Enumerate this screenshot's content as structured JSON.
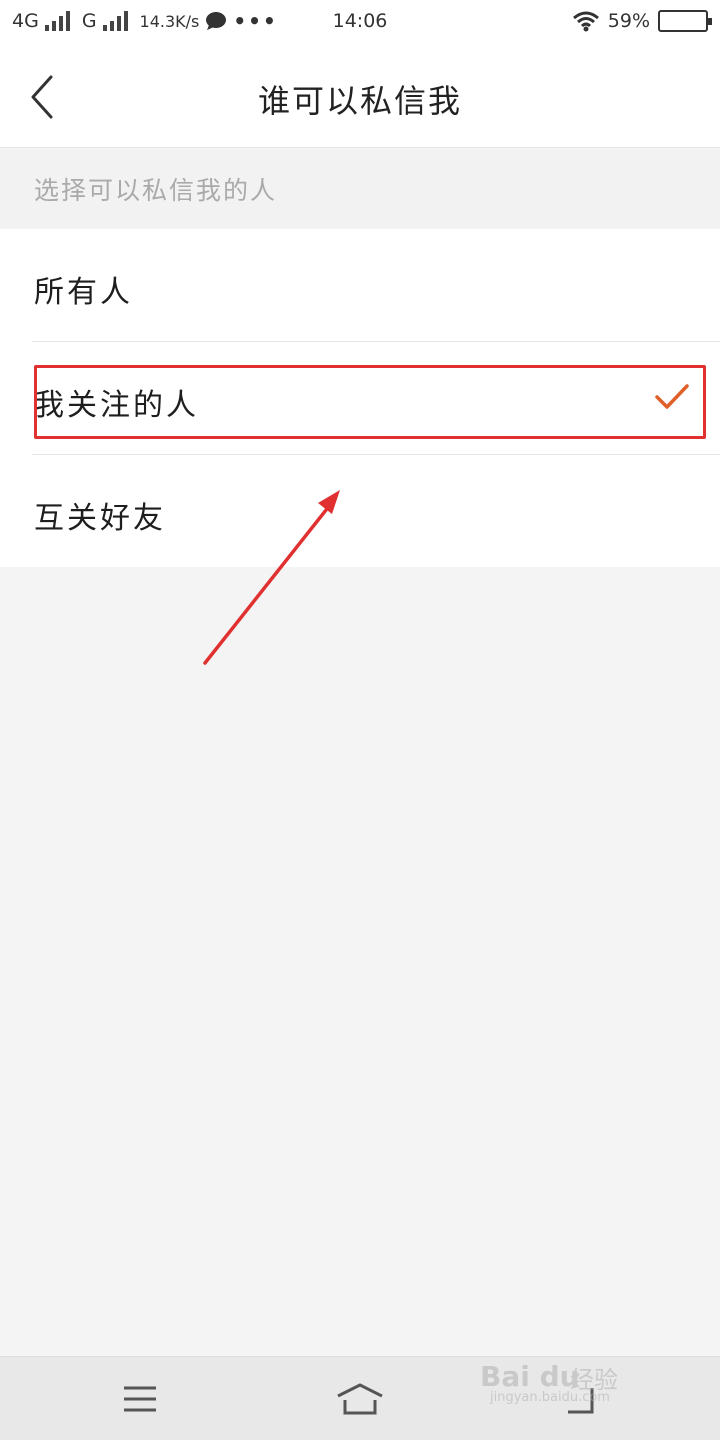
{
  "status_bar": {
    "network_1": "4G",
    "network_2": "G",
    "speed": "14.3K/s",
    "time": "14:06",
    "battery": "59%"
  },
  "nav": {
    "title": "谁可以私信我"
  },
  "section": {
    "header": "选择可以私信我的人"
  },
  "options": [
    {
      "label": "所有人",
      "selected": false
    },
    {
      "label": "我关注的人",
      "selected": true
    },
    {
      "label": "互关好友",
      "selected": false
    }
  ],
  "colors": {
    "accent_check": "#e0602a",
    "annotation_red": "#e03030"
  },
  "watermark": {
    "logo": "Bai du",
    "text": "经验",
    "url": "jingyan.baidu.com"
  },
  "icons": [
    "back-chevron-icon",
    "checkmark-icon",
    "menu-icon",
    "home-icon",
    "back-icon",
    "wifi-icon",
    "chat-icon",
    "battery-icon",
    "signal-icon"
  ]
}
